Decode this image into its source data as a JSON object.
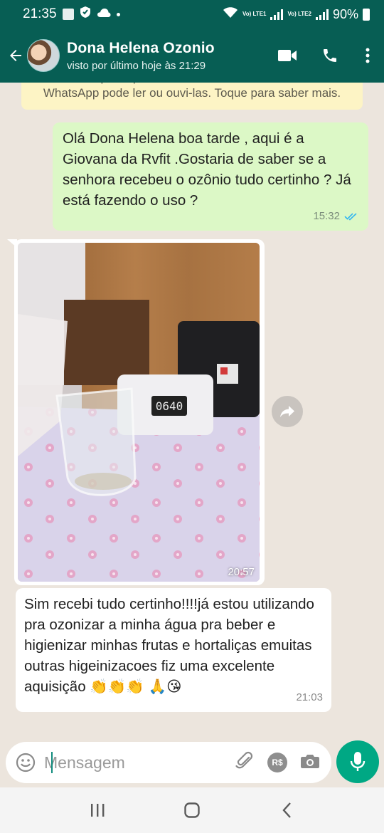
{
  "status_bar": {
    "time": "21:35",
    "battery": "90%",
    "sim1": "Vo) LTE1",
    "sim2": "Vo) LTE2"
  },
  "header": {
    "contact_name": "Dona Helena Ozonio",
    "last_seen": "visto por último hoje às 21:29"
  },
  "chat": {
    "encryption_notice": "Você e os participantes desta conversa. Nem mesmo o WhatsApp pode ler ou ouvi-las. Toque para saber mais.",
    "messages": [
      {
        "direction": "outgoing",
        "text": "Olá Dona Helena boa tarde , aqui é a Giovana da Rvfit .Gostaria de saber se a senhora recebeu o ozônio tudo certinho ? Já está fazendo o uso ?",
        "time": "15:32",
        "status": "read"
      },
      {
        "direction": "incoming",
        "type": "image",
        "device_display": "0640",
        "time": "20:57"
      },
      {
        "direction": "incoming",
        "text": "Sim recebi  tudo certinho!!!!já  estou utilizando  pra ozonizar a minha água pra beber e higienizar minhas frutas  e hortaliças emuitas outras higeinizacoes fiz uma excelente  aquisição 👏👏👏 🙏😘",
        "time": "21:03"
      }
    ]
  },
  "composer": {
    "placeholder": "Mensagem",
    "payment_label": "R$"
  },
  "colors": {
    "header": "#075e54",
    "outgoing_bubble": "#dcf8c6",
    "incoming_bubble": "#ffffff",
    "mic_button": "#00a884",
    "read_ticks": "#34b7f1"
  }
}
